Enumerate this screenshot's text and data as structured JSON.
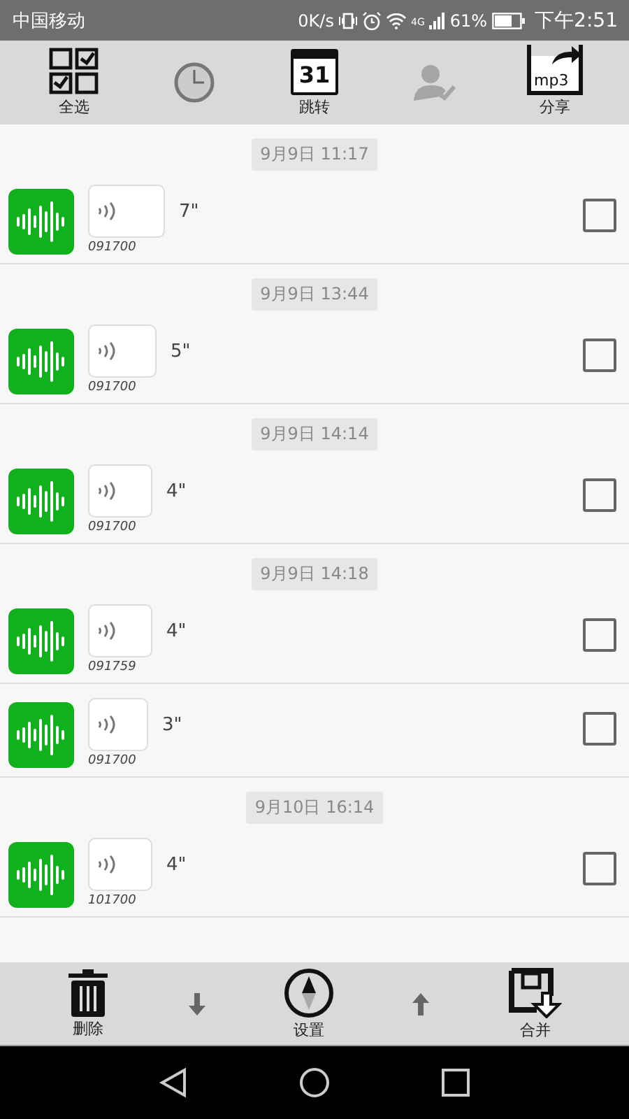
{
  "status_bar": {
    "carrier": "中国移动",
    "speed": "0K/s",
    "network": "4G",
    "battery": "61%",
    "time": "下午2:51"
  },
  "toolbar": [
    {
      "kind": "select-all",
      "label": "全选",
      "disabled": false
    },
    {
      "kind": "clock",
      "disabled": false
    },
    {
      "kind": "calendar",
      "label": "跳转",
      "calendar_day": "31",
      "disabled": false
    },
    {
      "kind": "person",
      "disabled": true
    },
    {
      "kind": "share",
      "label": "分享",
      "file_type": "mp3",
      "disabled": false
    }
  ],
  "recordings": [
    {
      "date": "9月9日 11:17",
      "duration": "7\"",
      "code": "091700",
      "checked": false
    },
    {
      "date": "9月9日 13:44",
      "duration": "5\"",
      "code": "091700",
      "checked": false
    },
    {
      "date": "9月9日 14:14",
      "duration": "4\"",
      "code": "091700",
      "checked": false
    },
    {
      "date": "9月9日 14:18",
      "duration": "4\"",
      "code": "091759",
      "checked": false
    },
    {
      "duration": "3\"",
      "code": "091700",
      "checked": false
    },
    {
      "date": "9月10日 16:14",
      "duration": "4\"",
      "code": "101700",
      "checked": false
    }
  ],
  "bottom_bar": [
    {
      "kind": "delete",
      "label": "删除"
    },
    {
      "kind": "down"
    },
    {
      "kind": "settings",
      "label": "设置"
    },
    {
      "kind": "up"
    },
    {
      "kind": "merge",
      "label": "合并"
    }
  ]
}
